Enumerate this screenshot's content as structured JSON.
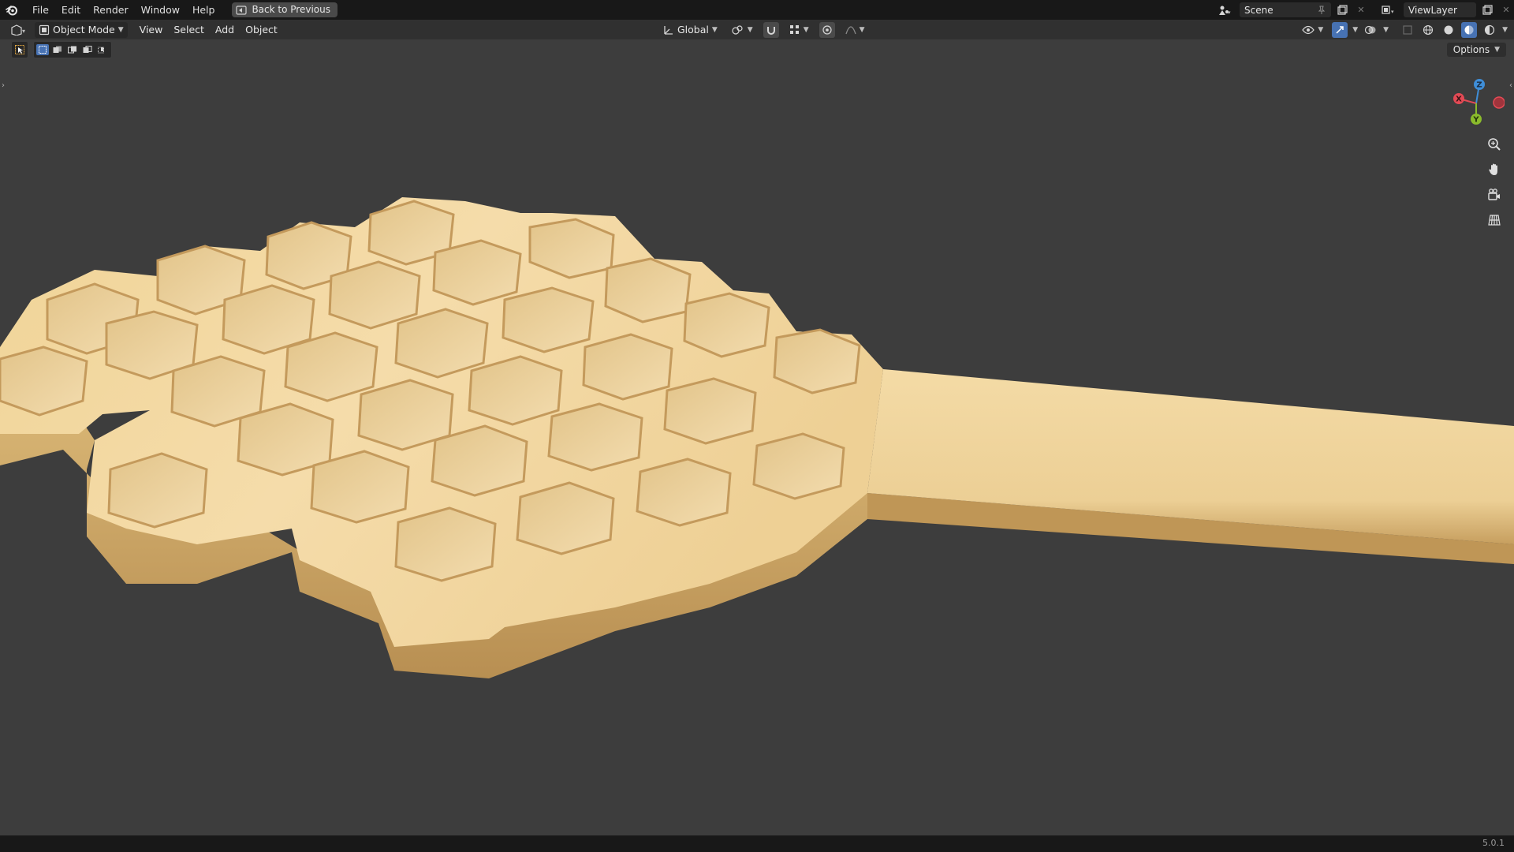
{
  "topbar": {
    "menus": [
      "File",
      "Edit",
      "Render",
      "Window",
      "Help"
    ],
    "back_button": "Back to Previous",
    "scene_name": "Scene",
    "view_layer": "ViewLayer"
  },
  "header": {
    "mode": "Object Mode",
    "menus": [
      "View",
      "Select",
      "Add",
      "Object"
    ],
    "transform_orientation": "Global"
  },
  "viewport": {
    "options_label": "Options",
    "gizmo_axes": {
      "x": "X",
      "y": "Y",
      "z": "Z"
    },
    "colors": {
      "x_axis": "#e34a55",
      "y_axis": "#8bbb2c",
      "z_axis": "#3f8ed8",
      "wood_light": "#f3d9a0",
      "wood_dark": "#c9a061",
      "background": "#3d3d3d",
      "accent": "#4772b3"
    }
  },
  "status": {
    "version": "5.0.1"
  }
}
